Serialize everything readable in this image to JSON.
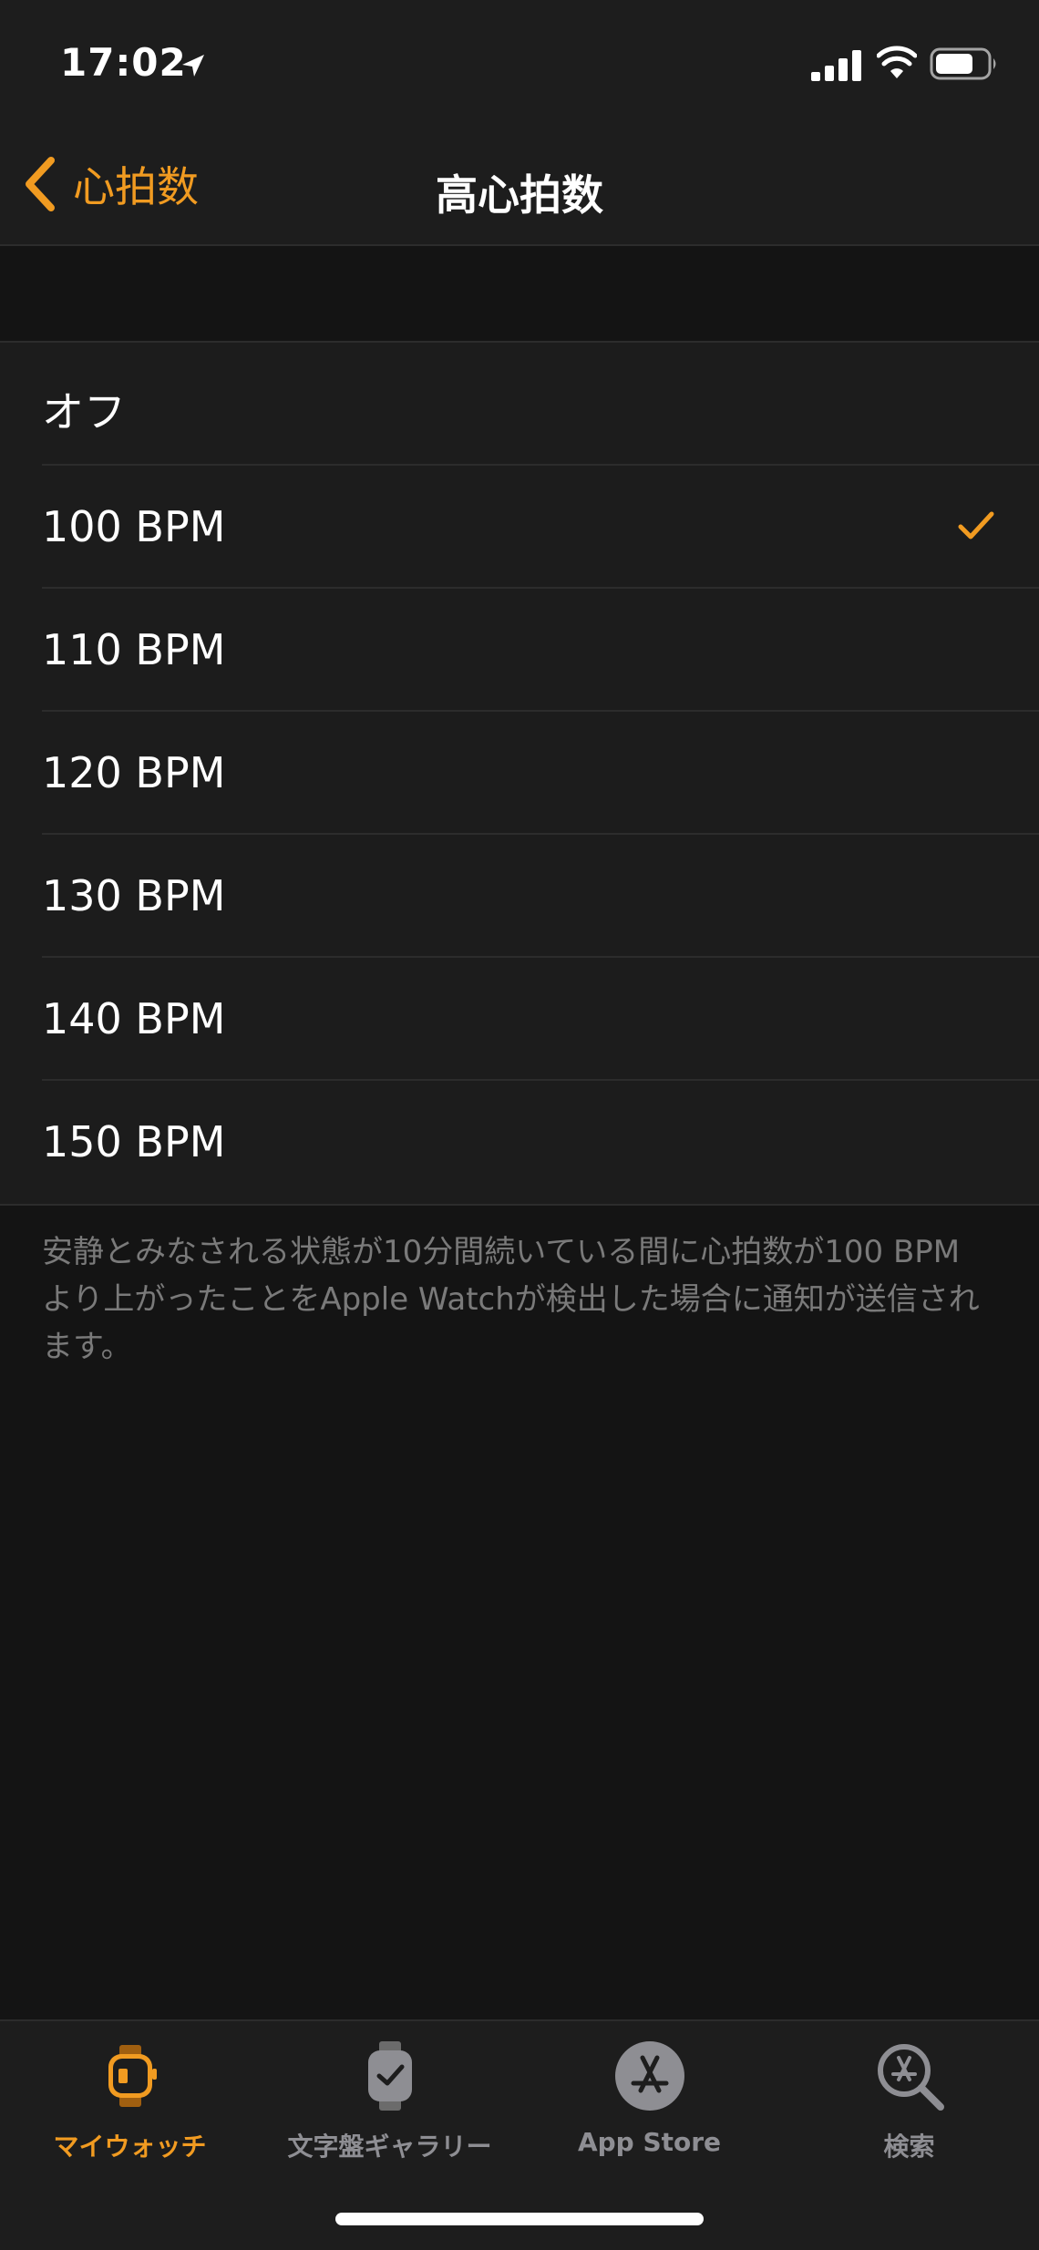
{
  "status_bar": {
    "time": "17:02"
  },
  "nav": {
    "back_label": "心拍数",
    "title": "高心拍数"
  },
  "options": [
    {
      "label": "オフ",
      "selected": false
    },
    {
      "label": "100 BPM",
      "selected": true
    },
    {
      "label": "110 BPM",
      "selected": false
    },
    {
      "label": "120 BPM",
      "selected": false
    },
    {
      "label": "130 BPM",
      "selected": false
    },
    {
      "label": "140 BPM",
      "selected": false
    },
    {
      "label": "150 BPM",
      "selected": false
    }
  ],
  "footer": {
    "text": "安静とみなされる状態が10分間続いている間に心拍数が100 BPMより上がったことをApple Watchが検出した場合に通知が送信されます。"
  },
  "tabs": [
    {
      "label": "マイウォッチ",
      "icon": "my-watch-icon",
      "active": true
    },
    {
      "label": "文字盤ギャラリー",
      "icon": "face-gallery-icon",
      "active": false
    },
    {
      "label": "App Store",
      "icon": "app-store-icon",
      "active": false
    },
    {
      "label": "検索",
      "icon": "search-icon",
      "active": false
    }
  ],
  "colors": {
    "accent": "#f19b21",
    "background": "#141414",
    "cell": "#1c1c1c",
    "secondary_text": "#7a7a7a",
    "inactive_tab": "#8e8e93"
  }
}
